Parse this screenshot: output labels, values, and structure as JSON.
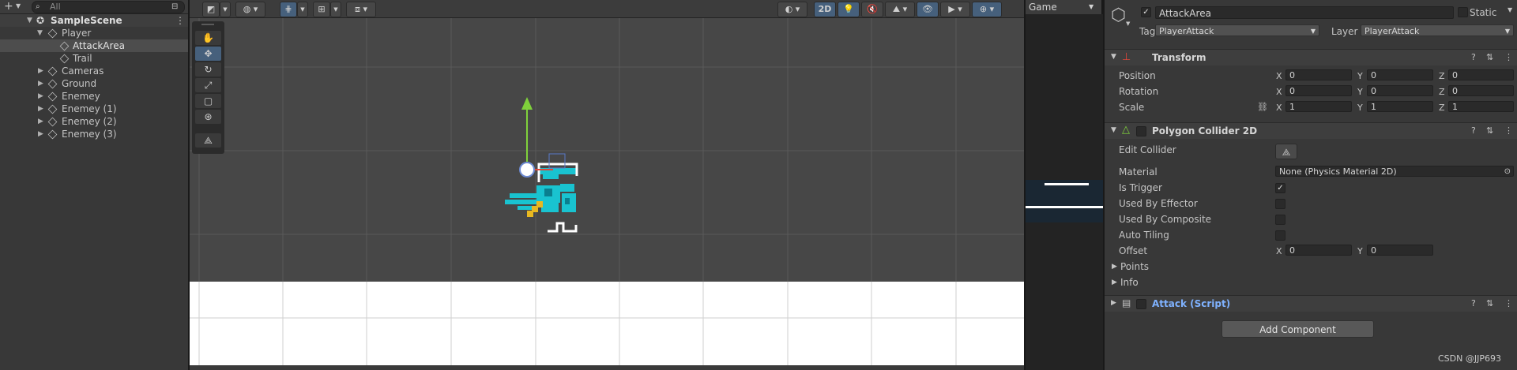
{
  "hierarchy": {
    "add_icon": "+",
    "search_placeholder": "All",
    "rows": [
      {
        "label": "SampleScene",
        "indent": 0
      },
      {
        "label": "Player",
        "indent": 1
      },
      {
        "label": "AttackArea",
        "indent": 2
      },
      {
        "label": "Trail",
        "indent": 2
      },
      {
        "label": "Cameras",
        "indent": 1
      },
      {
        "label": "Ground",
        "indent": 1
      },
      {
        "label": "Enemey",
        "indent": 1
      },
      {
        "label": "Enemey (1)",
        "indent": 1
      },
      {
        "label": "Enemey (2)",
        "indent": 1
      },
      {
        "label": "Enemey (3)",
        "indent": 1
      }
    ]
  },
  "scene_toolbar": {
    "mode_2d": "2D"
  },
  "game": {
    "tab_label": "Game"
  },
  "inspector": {
    "object_name": "AttackArea",
    "static_label": "Static",
    "tag_label": "Tag",
    "tag_value": "PlayerAttack",
    "layer_label": "Layer",
    "layer_value": "PlayerAttack",
    "transform": {
      "title": "Transform",
      "position_label": "Position",
      "rotation_label": "Rotation",
      "scale_label": "Scale",
      "position": {
        "x": "0",
        "y": "0",
        "z": "0"
      },
      "rotation": {
        "x": "0",
        "y": "0",
        "z": "0"
      },
      "scale": {
        "x": "1",
        "y": "1",
        "z": "1"
      },
      "axis_x": "X",
      "axis_y": "Y",
      "axis_z": "Z"
    },
    "collider": {
      "title": "Polygon Collider 2D",
      "edit_collider_label": "Edit Collider",
      "material_label": "Material",
      "material_value": "None (Physics Material 2D)",
      "is_trigger_label": "Is Trigger",
      "is_trigger": true,
      "used_by_effector_label": "Used By Effector",
      "used_by_composite_label": "Used By Composite",
      "auto_tiling_label": "Auto Tiling",
      "offset_label": "Offset",
      "offset": {
        "x": "0",
        "y": "0"
      },
      "points_label": "Points",
      "info_label": "Info"
    },
    "script": {
      "title": "Attack (Script)"
    },
    "add_component_label": "Add Component"
  },
  "watermark": "CSDN @JJP693",
  "colors": {
    "panel": "#383838",
    "scene_bg": "#474747",
    "ground": "#ffffff",
    "selection": "#46607c",
    "script_title": "#7fb2ff",
    "gizmo_x": "#e0463a",
    "gizmo_y": "#7fd13b",
    "sprite_cyan": "#19c3d0"
  }
}
